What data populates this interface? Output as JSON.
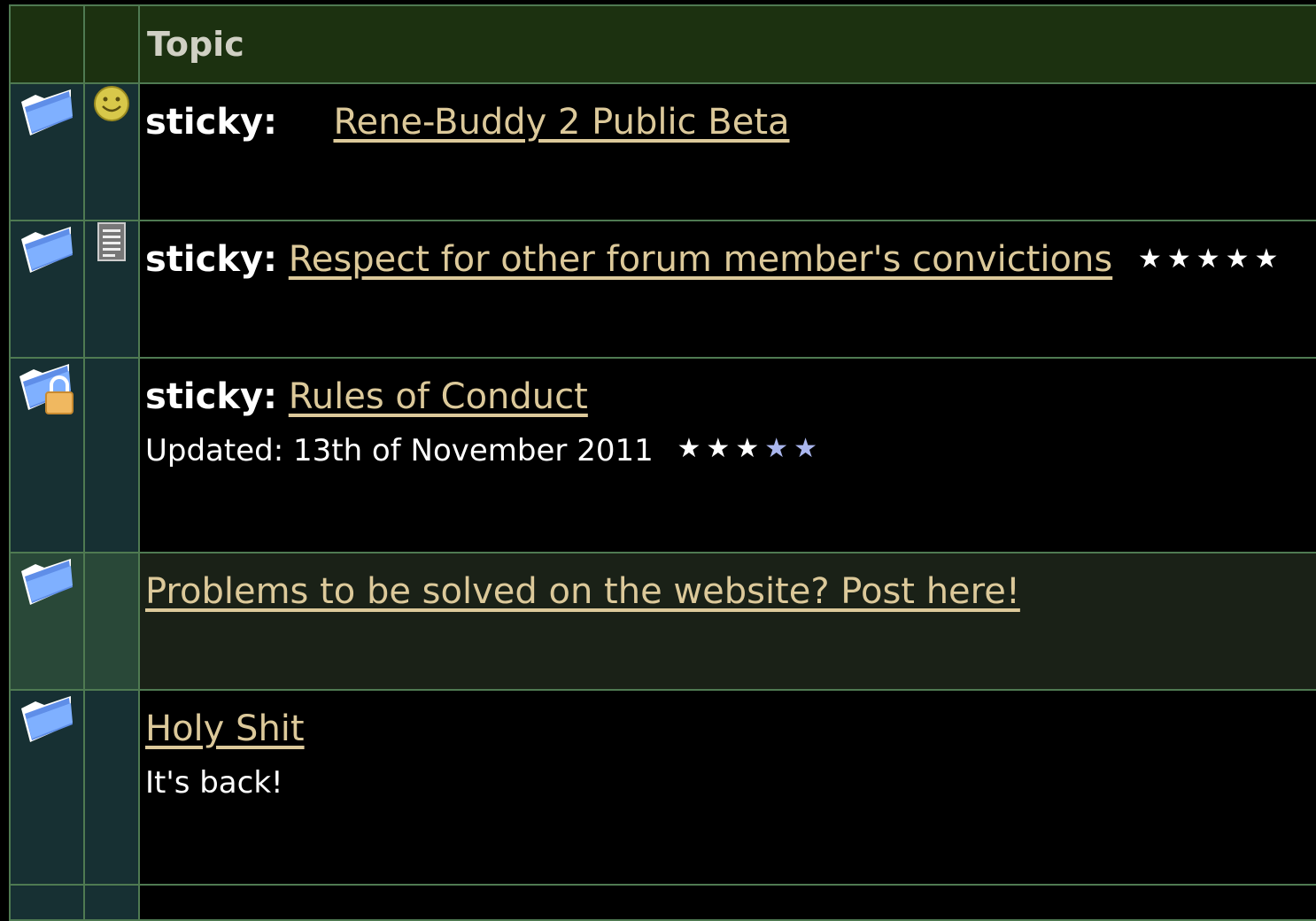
{
  "header": {
    "topic_label": "Topic"
  },
  "icons": {
    "folder": "folder-icon",
    "locked_folder": "locked-folder-icon",
    "smile": "smiley-icon",
    "note": "note-icon"
  },
  "colors": {
    "header_bg": "#1c3110",
    "link": "#dcc99a",
    "border": "#4f7a52"
  },
  "topics": [
    {
      "prefix": "sticky:",
      "title": "Rene-Buddy 2 Public Beta",
      "msg_icon": "smiley-icon"
    },
    {
      "prefix": "sticky:",
      "title": "Respect for other forum member's convictions",
      "msg_icon": "note-icon",
      "rating": "★★★★★",
      "rating_value": 5
    },
    {
      "prefix": "sticky:",
      "title": "Rules of Conduct",
      "subtitle": "Updated: 13th of November 2011",
      "locked": true,
      "rating": "★★★★★",
      "rating_value": 3
    },
    {
      "title": "Problems to be solved on the website? Post here!"
    },
    {
      "title": "Holy Shit",
      "subtitle": "It's back!"
    }
  ]
}
